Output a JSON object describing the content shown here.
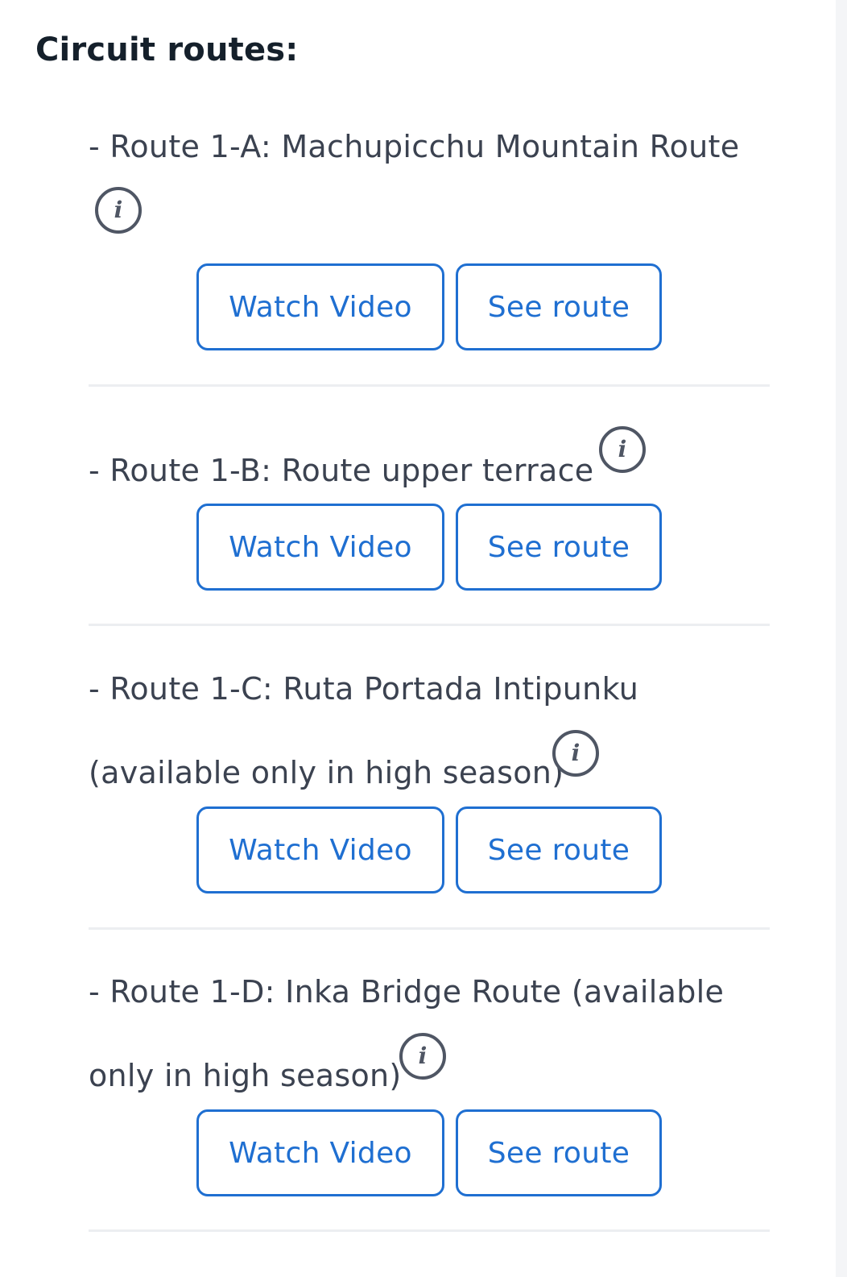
{
  "heading": "Circuit routes:",
  "routes": [
    {
      "lines": [
        "- Route 1-A: Machupicchu Mountain Route"
      ],
      "video_label": "Watch Video",
      "route_label": "See route"
    },
    {
      "lines": [
        "- Route 1-B: Route upper terrace"
      ],
      "video_label": "Watch Video",
      "route_label": "See route"
    },
    {
      "lines": [
        "- Route 1-C: Ruta Portada Intipunku",
        "(available only in high season)"
      ],
      "video_label": "Watch Video",
      "route_label": "See route"
    },
    {
      "lines": [
        "- Route 1-D: Inka Bridge Route (available",
        "only in high season)"
      ],
      "video_label": "Watch Video",
      "route_label": "See route"
    }
  ],
  "info_icon_glyph": "i",
  "colors": {
    "heading": "#15202b",
    "text": "#3b4250",
    "accent": "#1f6fd1",
    "divider": "#eceef1",
    "icon": "#4f5664"
  },
  "icons": {
    "info": "info-icon"
  }
}
